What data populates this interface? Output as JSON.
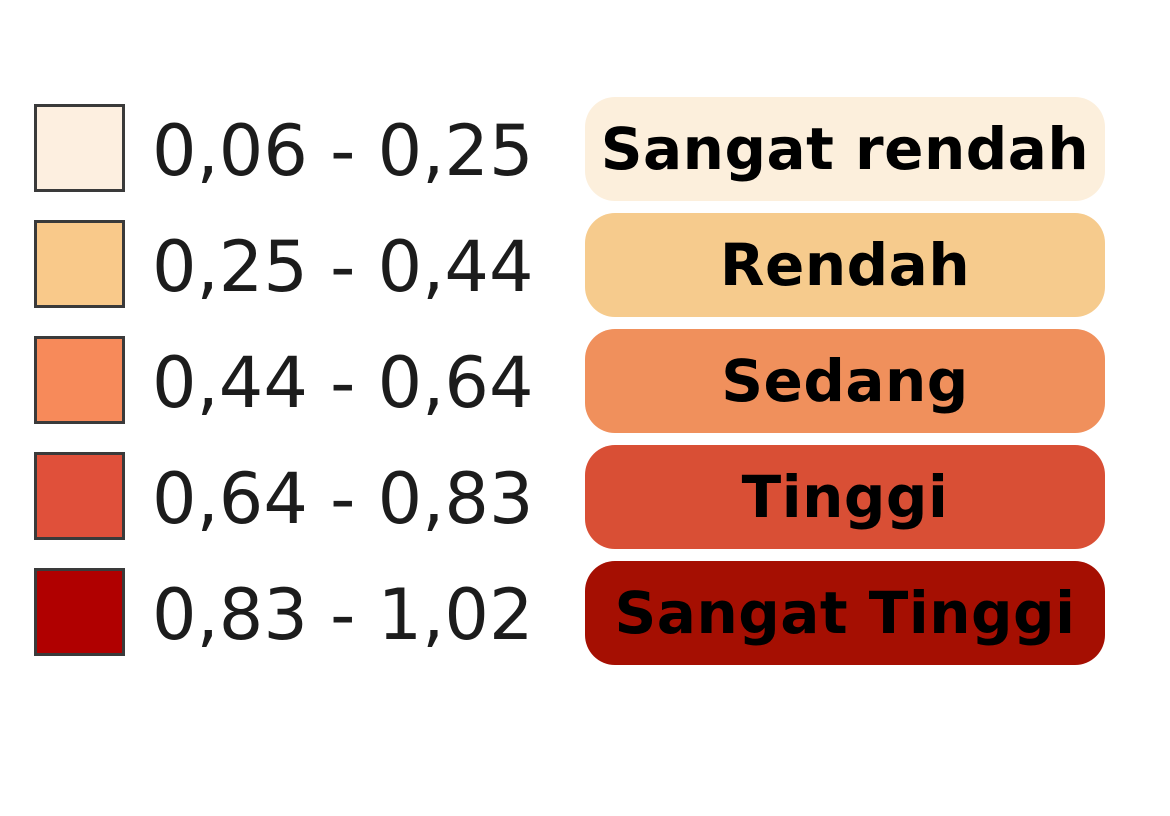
{
  "legend": {
    "classes": [
      {
        "range": "0,06 - 0,25",
        "label": "Sangat rendah",
        "swatch_color": "#fdefe0",
        "pill_color": "#fcefdc"
      },
      {
        "range": "0,25 - 0,44",
        "label": "Rendah",
        "swatch_color": "#f9c98a",
        "pill_color": "#f6cb8d"
      },
      {
        "range": "0,44 - 0,64",
        "label": "Sedang",
        "swatch_color": "#f78a5a",
        "pill_color": "#f0905c"
      },
      {
        "range": "0,64 - 0,83",
        "label": "Tinggi",
        "swatch_color": "#e0503a",
        "pill_color": "#d94f35"
      },
      {
        "range": "0,83 - 1,02",
        "label": "Sangat Tinggi",
        "swatch_color": "#b00000",
        "pill_color": "#a50f02"
      }
    ]
  }
}
